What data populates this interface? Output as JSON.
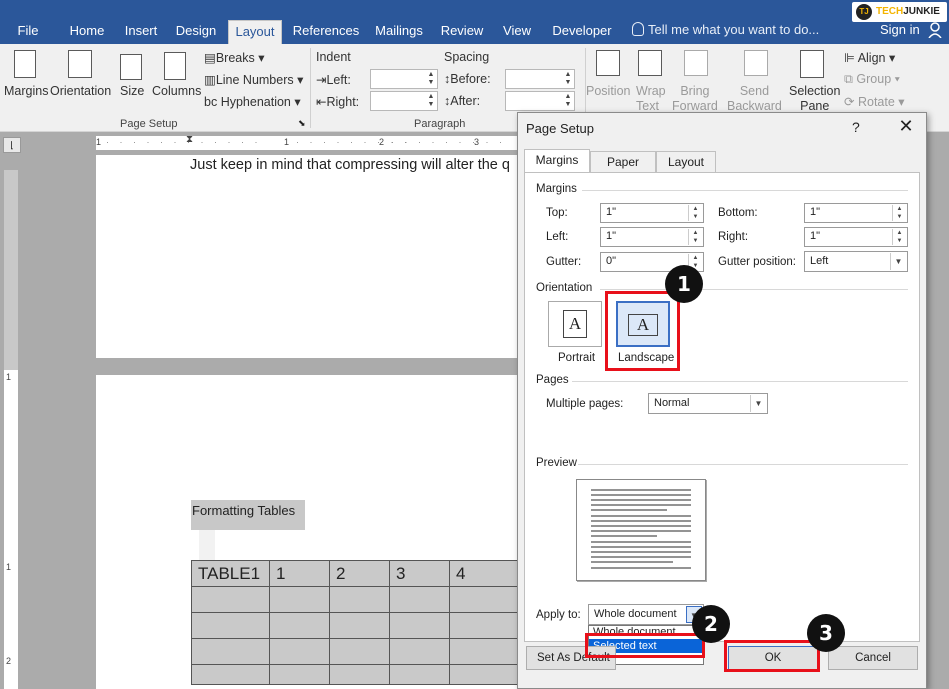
{
  "ribbon_tabs": [
    "File",
    "Home",
    "Insert",
    "Design",
    "Layout",
    "References",
    "Mailings",
    "Review",
    "View",
    "Developer"
  ],
  "tell_me": "Tell me what you want to do...",
  "sign_in": "Sign in",
  "watermark": {
    "t": "TJ",
    "brand_a": "TECH",
    "brand_b": "JUNKIE"
  },
  "page_setup_group": {
    "margins": "Margins",
    "orientation": "Orientation",
    "size": "Size",
    "columns": "Columns",
    "breaks": "Breaks",
    "line_numbers": "Line Numbers",
    "hyphenation": "Hyphenation",
    "group_label": "Page Setup"
  },
  "paragraph_group": {
    "indent": "Indent",
    "spacing": "Spacing",
    "left": "Left:",
    "right": "Right:",
    "before": "Before:",
    "after": "After:",
    "group_label": "Paragraph"
  },
  "arrange_group": {
    "position": [
      "Position"
    ],
    "wrap_text": [
      "Wrap",
      "Text"
    ],
    "bring_forward": [
      "Bring",
      "Forward"
    ],
    "send_backward": [
      "Send",
      "Backward"
    ],
    "selection_pane": [
      "Selection",
      "Pane"
    ],
    "align": "Align",
    "group": "Group",
    "rotate": "Rotate"
  },
  "ruler_numbers": [
    "1",
    "1",
    "2",
    "3"
  ],
  "vruler_numbers": [
    "1",
    "1",
    "2"
  ],
  "document": {
    "text_line": "Just keep in mind that compressing will alter the q",
    "formatting_label": "Formatting Tables",
    "table_header": [
      "TABLE1",
      "1",
      "2",
      "3",
      "4"
    ]
  },
  "dialog": {
    "title": "Page Setup",
    "help": "?",
    "tabs": [
      "Margins",
      "Paper",
      "Layout"
    ],
    "margins_section": "Margins",
    "top_label": "Top:",
    "top_value": "1\"",
    "bottom_label": "Bottom:",
    "bottom_value": "1\"",
    "left_label": "Left:",
    "left_value": "1\"",
    "right_label": "Right:",
    "right_value": "1\"",
    "gutter_label": "Gutter:",
    "gutter_value": "0\"",
    "gutter_position_label": "Gutter position:",
    "gutter_position_value": "Left",
    "orientation_section": "Orientation",
    "portrait": "Portrait",
    "landscape": "Landscape",
    "glyph": "A",
    "pages_section": "Pages",
    "multiple_pages_label": "Multiple pages:",
    "multiple_pages_value": "Normal",
    "preview_section": "Preview",
    "apply_to_label": "Apply to:",
    "apply_to_value": "Whole document",
    "apply_options": [
      "Whole document",
      "Selected text"
    ],
    "set_as_default": "Set As Default",
    "ok": "OK",
    "cancel": "Cancel"
  },
  "callouts": [
    "1",
    "2",
    "3"
  ],
  "colors": {
    "word_blue": "#2b579a",
    "callout_red": "#e8101a"
  }
}
